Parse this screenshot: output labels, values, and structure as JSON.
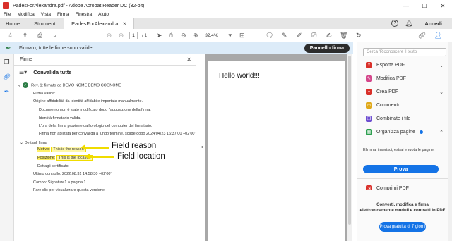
{
  "window": {
    "title": "PadesForAlexandra.pdf - Adobe Acrobat Reader DC (32-bit)"
  },
  "menu": [
    "File",
    "Modifica",
    "Vista",
    "Firma",
    "Finestra",
    "Aiuto"
  ],
  "tabs": {
    "home": "Home",
    "tools": "Strumenti",
    "document": "PadesForAlexandra...",
    "signin": "Accedi"
  },
  "toolbar": {
    "page_current": "1",
    "page_total": "/ 1",
    "zoom": "32,4%"
  },
  "signature_bar": {
    "message": "Firmato, tutte le firme sono valide.",
    "button": "Pannello firma"
  },
  "panel": {
    "title": "Firme",
    "validate_all": "Convalida tutte",
    "revision": "Rev. 1: firmato da DEMO NOME DEMO COGNOME",
    "lines": [
      "Firma valida:",
      "Origine affidabilità da identità affidabile importata manualmente.",
      "Documento non è stato modificato dopo l'apposizione della firma.",
      "Identità firmatario valida",
      "L'ora della firma proviene dall'orologio del computer del firmatario.",
      "Firma non abilitata per convalida a lungo termine, scade dopo 2024/04/23 16:37:00 +02'00'"
    ],
    "details_title": "Dettagli firma",
    "reason_label": "Motivo:",
    "reason_value": "This is the reason",
    "location_label": "Posizione:",
    "location_value": "This is the location",
    "certificate": "Dettagli certificato",
    "last_check": "Ultimo controllo: 2022.08.31 14:58:30 +02'00'",
    "field": "Campo: Signature1 a pagina 1",
    "view_version": "Fare clic per visualizzare questa versione"
  },
  "annotations": {
    "reason": "Field reason",
    "location": "Field location"
  },
  "document": {
    "text": "Hello world!!!"
  },
  "right_pane": {
    "search_placeholder": "Cerca 'Riconoscere il testo'",
    "tools": [
      {
        "label": "Esporta PDF",
        "color": "#d9302a",
        "arrow": "⌄"
      },
      {
        "label": "Modifica PDF",
        "color": "#d4468b",
        "arrow": ""
      },
      {
        "label": "Crea PDF",
        "color": "#d9302a",
        "arrow": "⌄"
      },
      {
        "label": "Commento",
        "color": "#e0a91a",
        "arrow": ""
      },
      {
        "label": "Combinate i file",
        "color": "#6e4fd1",
        "arrow": ""
      },
      {
        "label": "Organizza pagine",
        "color": "#2d9f4f",
        "arrow": "⌃"
      }
    ],
    "organize_desc": "Elimina, inserisci, estrai e ruota le pagine.",
    "prova": "Prova",
    "compress": "Comprimi PDF",
    "promo_text": "Converti, modifica e firma elettronicamente moduli e contratti in PDF",
    "promo_button": "Prova gratuita di 7 giorni"
  }
}
